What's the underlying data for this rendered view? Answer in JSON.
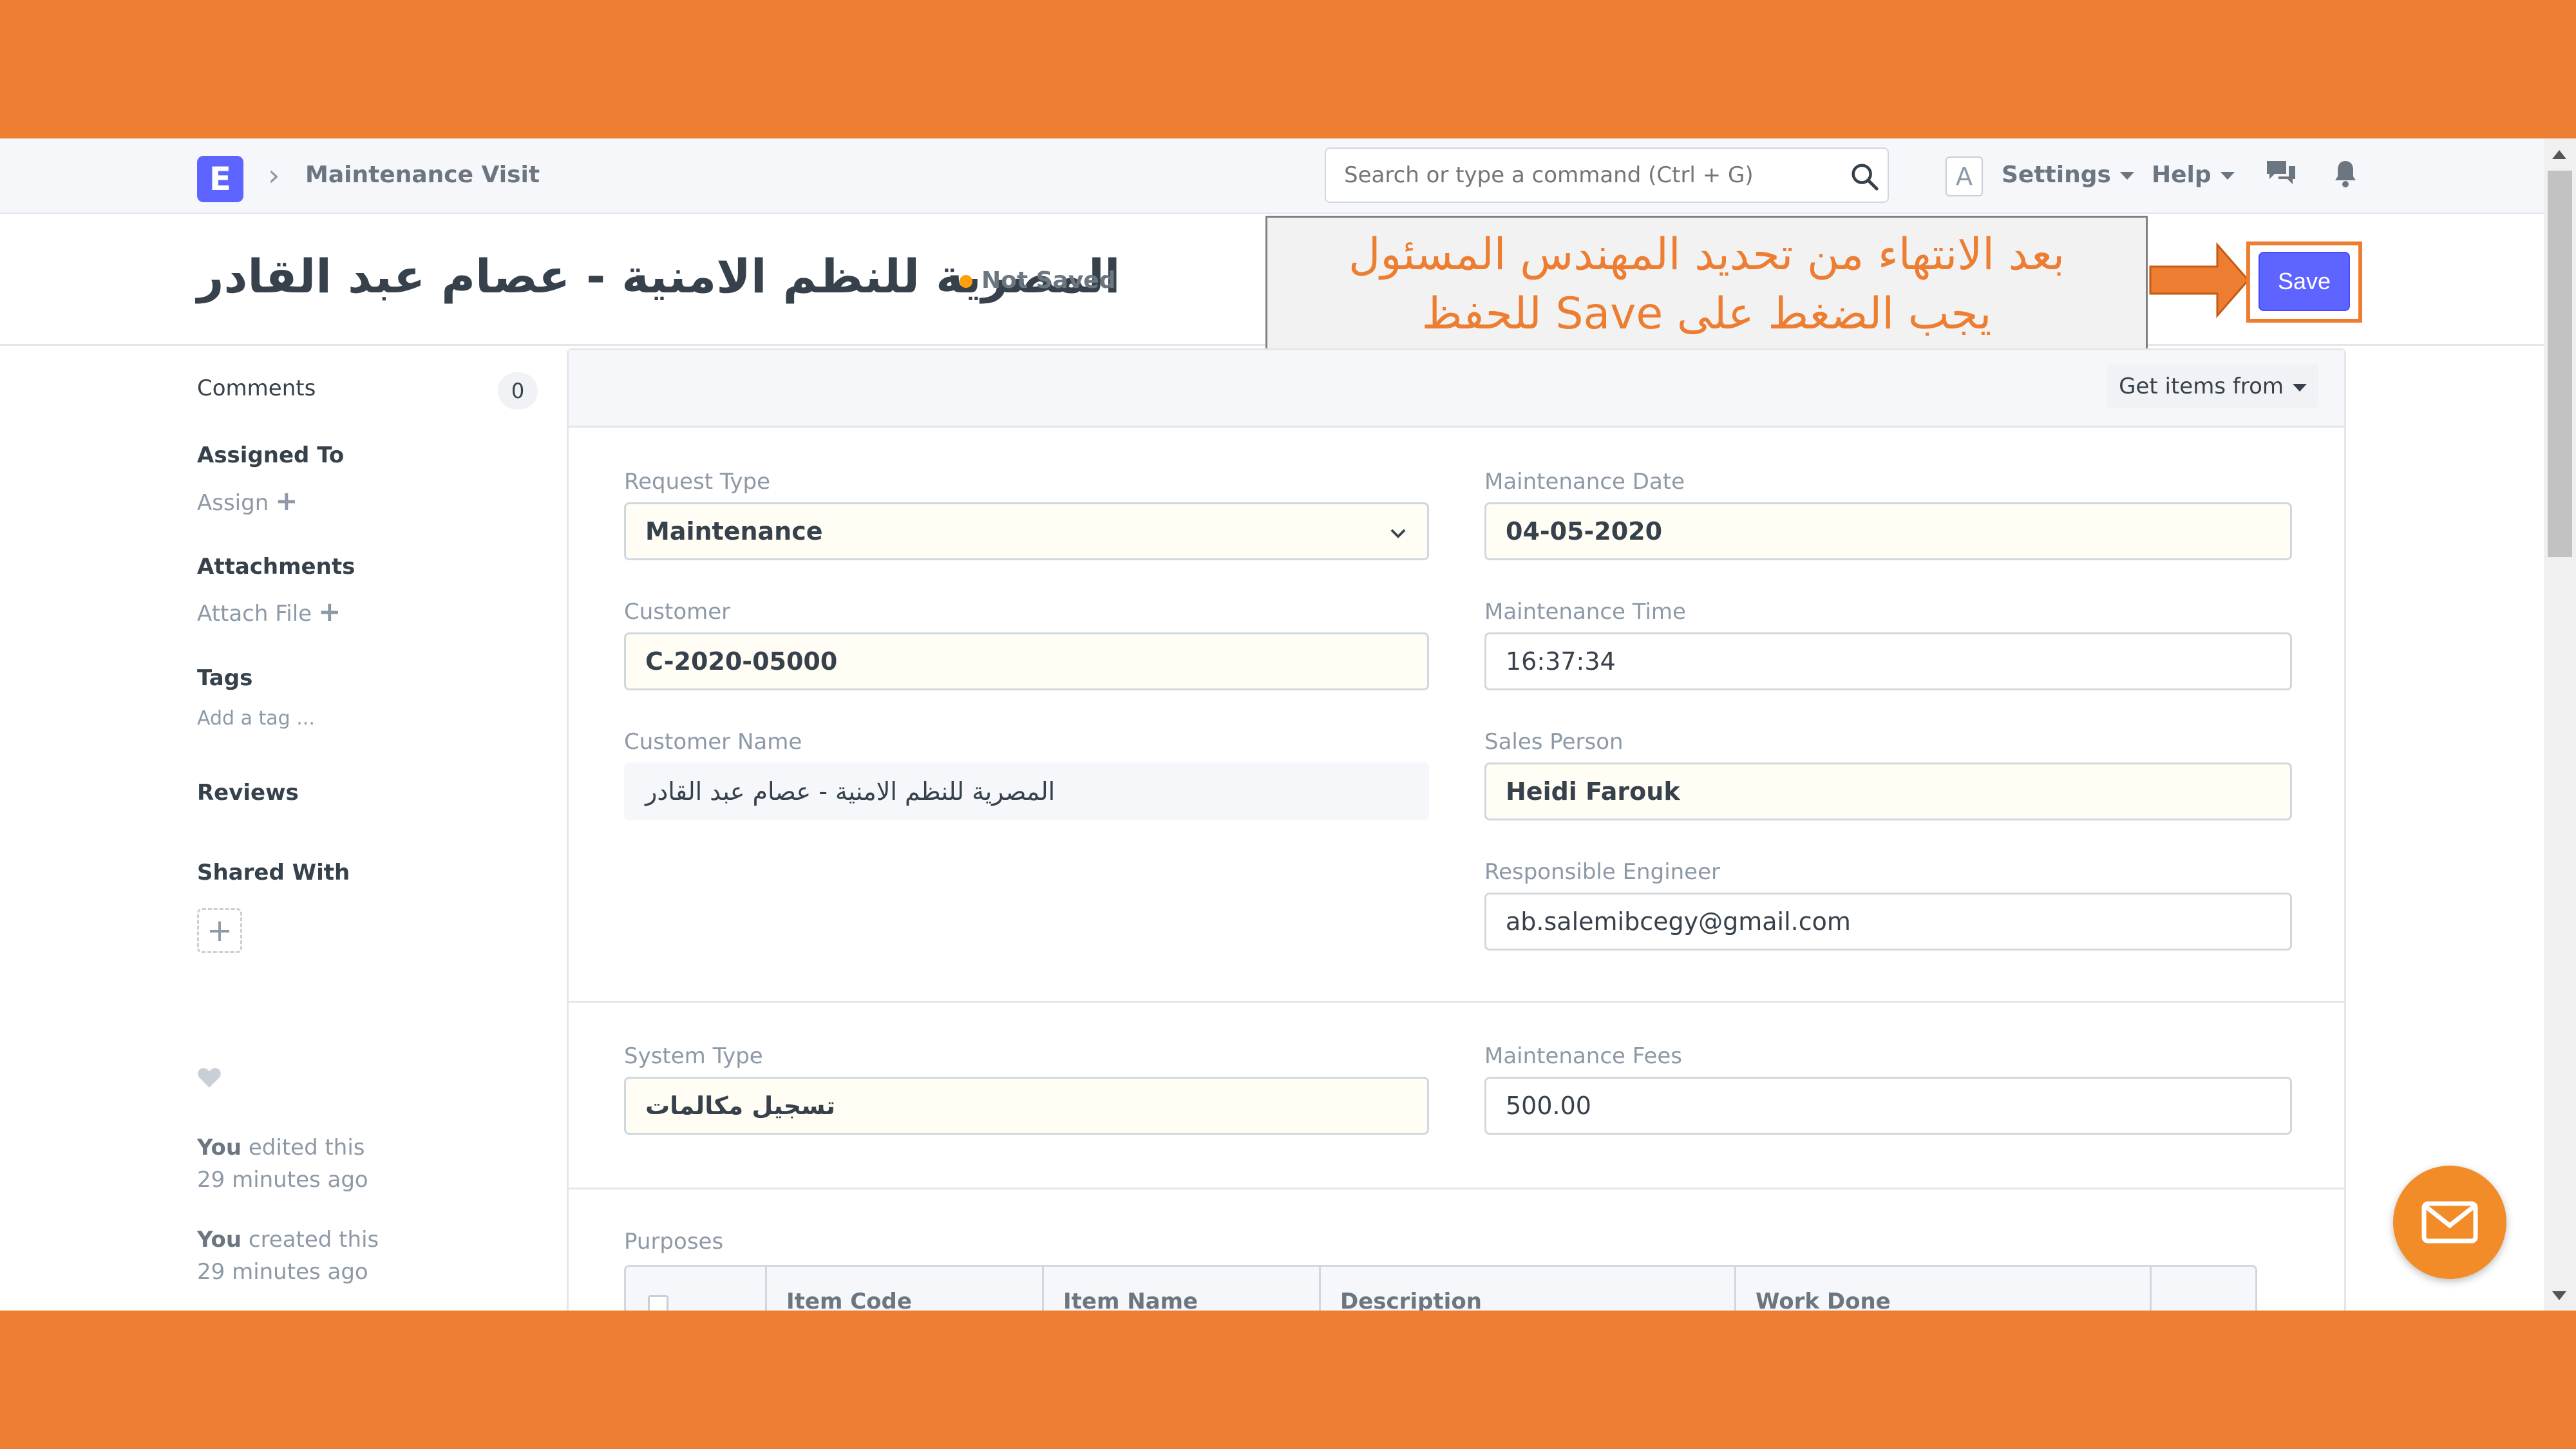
{
  "navbar": {
    "logo_letter": "E",
    "breadcrumb_sep": "›",
    "breadcrumb": "Maintenance Visit",
    "search_placeholder": "Search or type a command (Ctrl + G)",
    "avatar_letter": "A",
    "settings_label": "Settings",
    "help_label": "Help"
  },
  "page": {
    "title": "المصرية للنظم الامنية - عصام عبد القادر",
    "status": "Not Saved",
    "save_label": "Save"
  },
  "callout": {
    "line1": "بعد الانتهاء من تحديد المهندس المسئول",
    "line2": "يجب الضغط على Save للحفظ"
  },
  "sidebar": {
    "comments_label": "Comments",
    "comments_count": "0",
    "assigned_to_label": "Assigned To",
    "assign_label": "Assign",
    "attachments_label": "Attachments",
    "attach_file_label": "Attach File",
    "tags_label": "Tags",
    "add_tag_label": "Add a tag ...",
    "reviews_label": "Reviews",
    "shared_with_label": "Shared With",
    "share_plus": "+",
    "activity": [
      {
        "who": "You",
        "what": " edited this",
        "when": "29 minutes ago"
      },
      {
        "who": "You",
        "what": " created this",
        "when": "29 minutes ago"
      }
    ]
  },
  "form": {
    "get_items_label": "Get items from",
    "request_type_label": "Request Type",
    "request_type_value": "Maintenance",
    "customer_label": "Customer",
    "customer_value": "C-2020-05000",
    "customer_name_label": "Customer Name",
    "customer_name_value": "المصرية للنظم الامنية - عصام عبد القادر",
    "maintenance_date_label": "Maintenance Date",
    "maintenance_date_value": "04-05-2020",
    "maintenance_time_label": "Maintenance Time",
    "maintenance_time_value": "16:37:34",
    "sales_person_label": "Sales Person",
    "sales_person_value": "Heidi Farouk",
    "responsible_engineer_label": "Responsible Engineer",
    "responsible_engineer_value": "ab.salemibcegy@gmail.com",
    "system_type_label": "System Type",
    "system_type_value": "تسجيل مكالمات",
    "maintenance_fees_label": "Maintenance Fees",
    "maintenance_fees_value": "500.00",
    "purposes_label": "Purposes",
    "purposes_columns": [
      "Item Code",
      "Item Name",
      "Description",
      "Work Done"
    ]
  },
  "colors": {
    "accent": "#ED7D31",
    "primary": "#5E64FF",
    "indicator": "#FFA00A"
  }
}
